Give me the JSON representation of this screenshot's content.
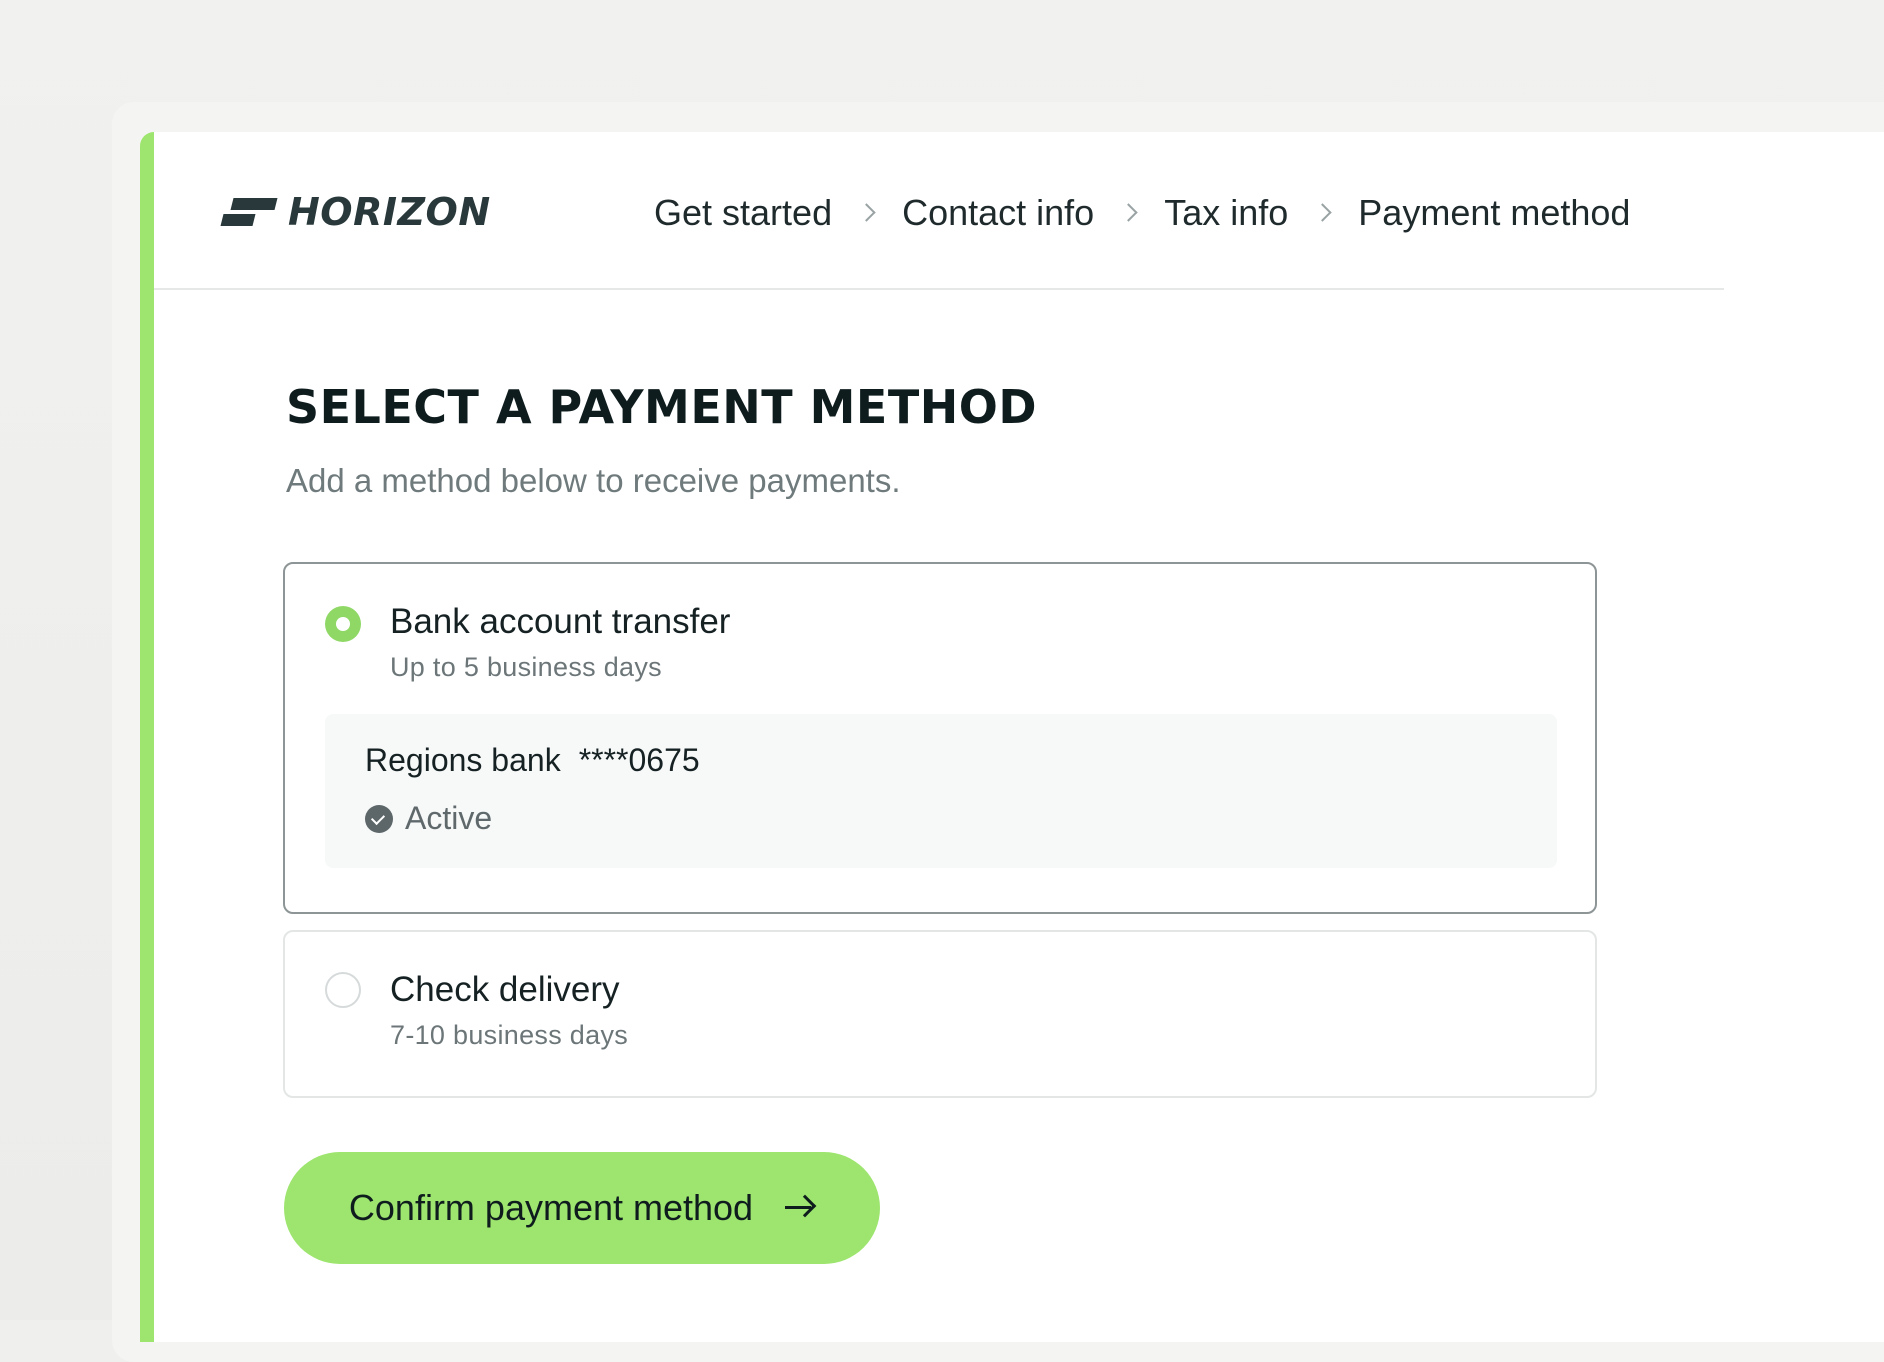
{
  "brand": {
    "name": "HORIZON"
  },
  "steps": [
    {
      "label": "Get started"
    },
    {
      "label": "Contact info"
    },
    {
      "label": "Tax info"
    },
    {
      "label": "Payment method"
    }
  ],
  "page": {
    "title": "SELECT A PAYMENT METHOD",
    "subtitle": "Add a method below to receive payments."
  },
  "options": [
    {
      "title": "Bank account transfer",
      "subtitle": "Up to 5 business days",
      "selected": true,
      "account": {
        "bank": "Regions bank",
        "number": "****0675",
        "status": "Active"
      }
    },
    {
      "title": "Check delivery",
      "subtitle": "7-10 business days",
      "selected": false
    }
  ],
  "cta": {
    "label": "Confirm payment method",
    "icon": "arrow-right-icon"
  },
  "colors": {
    "accent": "#9de56e",
    "radio_selected": "#8fd866",
    "text_dark": "#0f1c1e",
    "text_muted": "#6f7a7c"
  }
}
